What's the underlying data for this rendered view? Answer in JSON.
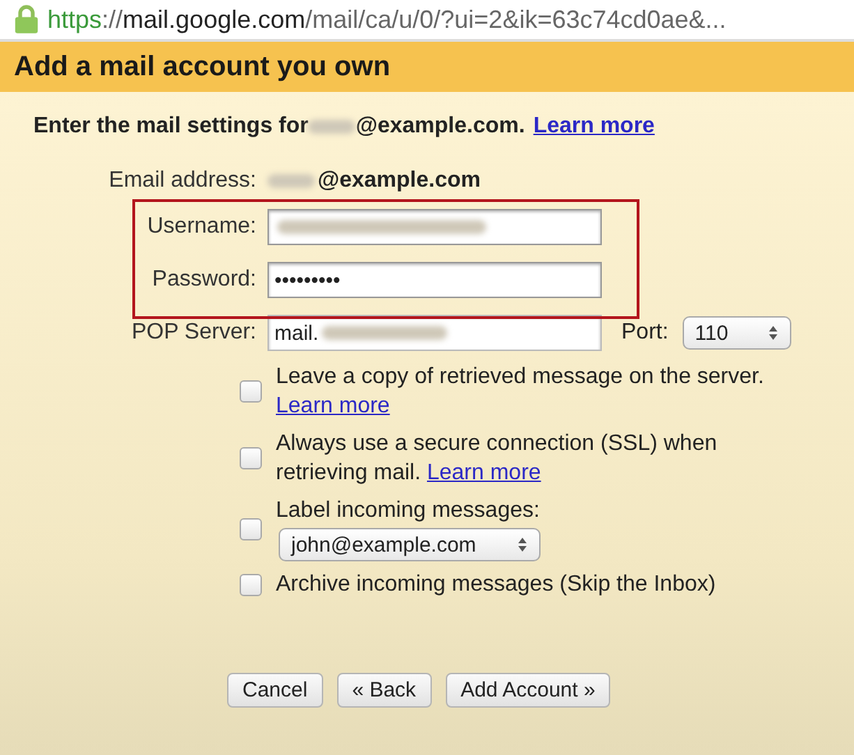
{
  "address_bar": {
    "scheme": "https",
    "url_host": "://mail.google.com",
    "url_path": "/mail/ca/u/0/?ui=2&ik=63c74cd0ae&..."
  },
  "dialog": {
    "title": "Add a mail account you own",
    "intro": {
      "text": "Enter the mail settings for",
      "email_suffix": "@example.com.",
      "link": "Learn more"
    },
    "email_address": {
      "label": "Email address:",
      "value_suffix": "@example.com"
    },
    "fields": [
      {
        "label": "Username:",
        "blurred": true,
        "highlighted": true
      },
      {
        "label": "Password:",
        "value": "•••••••••",
        "blurred": false,
        "highlighted": true
      },
      {
        "label": "POP Server:",
        "value": "mail.",
        "blurred": true,
        "highlighted": false
      }
    ],
    "port": {
      "label": "Port:",
      "value": "110"
    },
    "options": [
      {
        "kind": "text",
        "text": "Leave a copy of retrieved message on the server.",
        "link": "Learn more",
        "checked": false
      },
      {
        "kind": "text",
        "text": "Always use a secure connection (SSL) when retrieving mail.",
        "link": "Learn more",
        "checked": false
      },
      {
        "kind": "select",
        "text": "Label incoming messages:",
        "select_value": "john@example.com",
        "checked": false
      },
      {
        "kind": "text",
        "text": "Archive incoming messages (Skip the Inbox)",
        "checked": false
      }
    ],
    "buttons": [
      "Cancel",
      "« Back",
      "Add Account »"
    ]
  }
}
